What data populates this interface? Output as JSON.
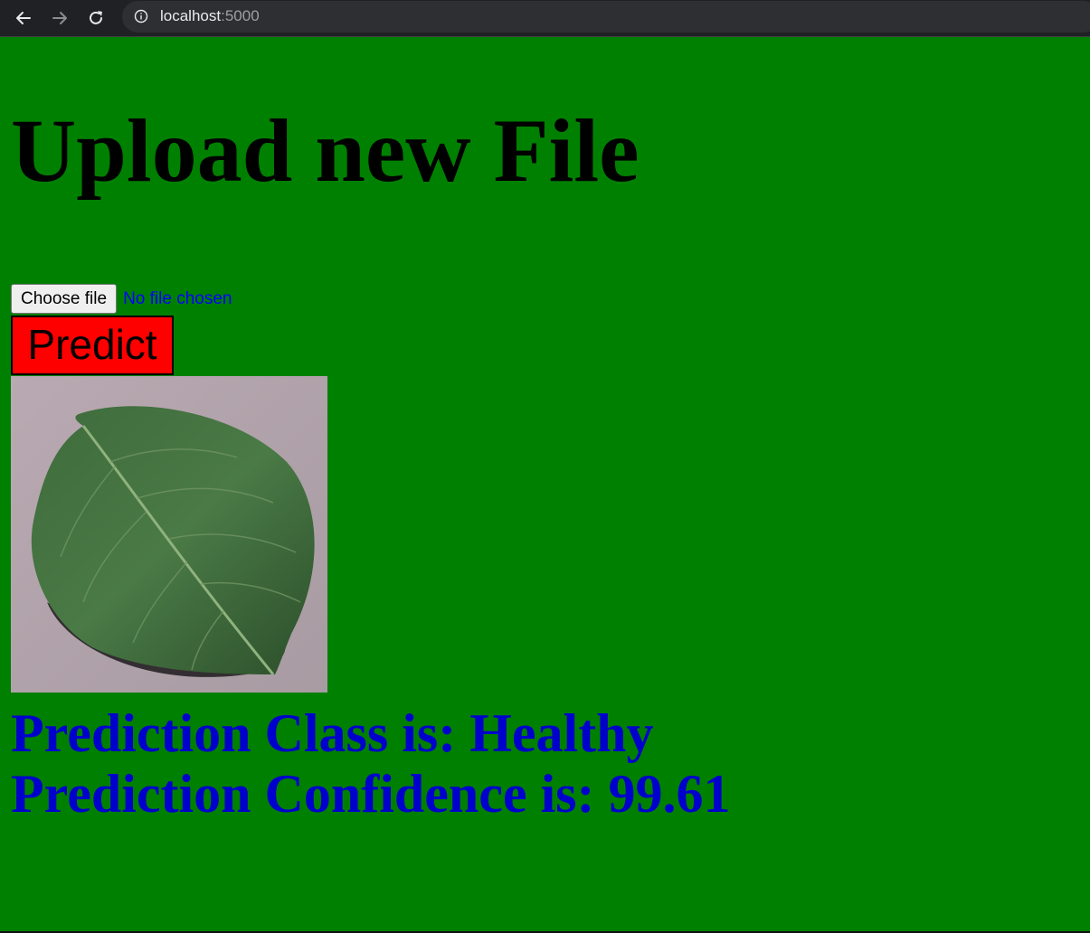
{
  "browser": {
    "url_host": "localhost",
    "url_port": ":5000",
    "icons": [
      "back-arrow-icon",
      "forward-arrow-icon",
      "reload-icon",
      "info-icon"
    ]
  },
  "page": {
    "title": "Upload new File",
    "choose_file_label": "Choose file",
    "file_status": "No file chosen",
    "predict_label": "Predict",
    "prediction_class_text": "Prediction Class is: Healthy",
    "prediction_confidence_text": "Prediction Confidence is: 99.61",
    "colors": {
      "background": "#008000",
      "predict_button": "#ff0000",
      "result_text": "#0000cc",
      "file_status_text": "#0000ff"
    }
  }
}
